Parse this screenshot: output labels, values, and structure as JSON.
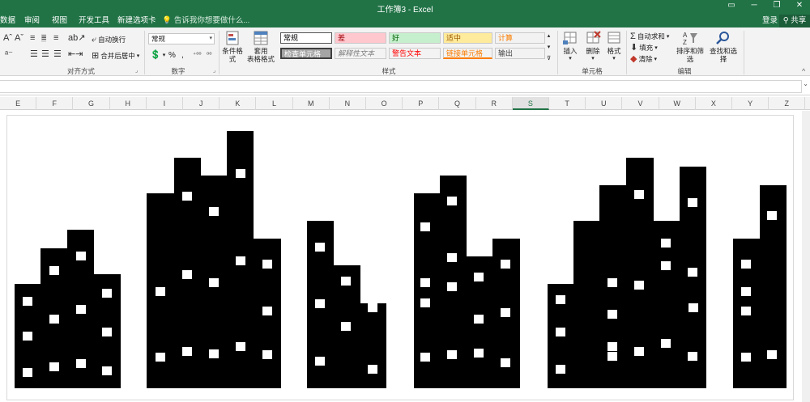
{
  "window": {
    "title": "工作簿3 - Excel",
    "controls": [
      "▭",
      "─",
      "❐",
      "✕"
    ]
  },
  "tabs": [
    "数据",
    "审阅",
    "视图",
    "开发工具",
    "新建选项卡"
  ],
  "tell_me": "告诉我你想要做什么...",
  "account": {
    "login": "登录",
    "share": "共享"
  },
  "ribbon": {
    "alignment": {
      "wrap": "自动换行",
      "merge": "合并后居中",
      "label": "对齐方式"
    },
    "number": {
      "format": "常规",
      "percent": "%",
      "comma": ",",
      "label": "数字"
    },
    "styles": {
      "cond_format": "条件格式",
      "table_format_1": "套用",
      "table_format_2": "表格格式",
      "cells": [
        {
          "text": "常规",
          "bg": "#ffffff",
          "fg": "#000000"
        },
        {
          "text": "差",
          "bg": "#ffc7ce",
          "fg": "#9c0006"
        },
        {
          "text": "好",
          "bg": "#c6efce",
          "fg": "#006100"
        },
        {
          "text": "适中",
          "bg": "#ffeb9c",
          "fg": "#9c5700"
        },
        {
          "text": "计算",
          "bg": "#f2f2f2",
          "fg": "#fa7d00"
        },
        {
          "text": "检查单元格",
          "bg": "#a5a5a5",
          "fg": "#ffffff"
        },
        {
          "text": "解释性文本",
          "bg": "#f3f3f3",
          "fg": "#7f7f7f"
        },
        {
          "text": "警告文本",
          "bg": "#f3f3f3",
          "fg": "#ff0000"
        },
        {
          "text": "链接单元格",
          "bg": "#f3f3f3",
          "fg": "#fa7d00"
        },
        {
          "text": "输出",
          "bg": "#f2f2f2",
          "fg": "#3f3f3f"
        }
      ],
      "label": "样式"
    },
    "cells_group": {
      "insert": "插入",
      "delete": "删除",
      "format": "格式",
      "label": "单元格"
    },
    "editing": {
      "autosum": "自动求和",
      "fill": "填充",
      "clear": "清除",
      "sort": "排序和筛选",
      "find": "查找和选择",
      "label": "编辑"
    }
  },
  "columns": [
    "E",
    "F",
    "G",
    "H",
    "I",
    "J",
    "K",
    "L",
    "M",
    "N",
    "O",
    "P",
    "Q",
    "R",
    "S",
    "T",
    "U",
    "V",
    "W",
    "X",
    "Y",
    "Z"
  ],
  "selected_column": "S",
  "colors": {
    "excel_green": "#217346",
    "building": "#000000",
    "window": "#ffffff"
  }
}
